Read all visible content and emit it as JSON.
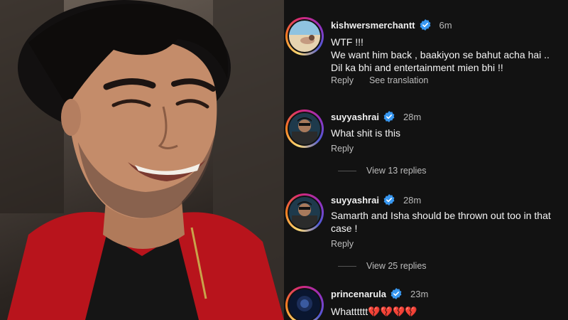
{
  "comments": [
    {
      "username": "kishwersmerchantt",
      "time": "6m",
      "text": "WTF !!!\nWe want him back , baakiyon se bahut acha hai .. Dil ka bhi and entertainment mien bhi !!",
      "reply_label": "Reply",
      "translation_label": "See translation",
      "avatar": "beach-photo"
    },
    {
      "username": "suyyashrai",
      "time": "28m",
      "text": "What shit is this",
      "reply_label": "Reply",
      "view_replies": "View 13 replies",
      "avatar": "man-in-car"
    },
    {
      "username": "suyyashrai",
      "time": "28m",
      "text": "Samarth and Isha should be thrown out too in that case !",
      "reply_label": "Reply",
      "view_replies": "View 25 replies",
      "avatar": "man-in-car"
    },
    {
      "username": "princenarula",
      "time": "23m",
      "text": "Whatttttt💔💔💔💔",
      "avatar": "dark-portrait"
    }
  ],
  "colors": {
    "panel_bg": "#121212",
    "verified": "#3897f0",
    "ring": [
      "#feda75",
      "#fa7e1e",
      "#d62976",
      "#962fbf",
      "#4f5bd5"
    ]
  }
}
